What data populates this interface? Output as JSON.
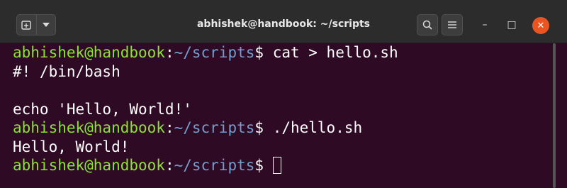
{
  "window": {
    "title": "abhishek@handbook: ~/scripts"
  },
  "toolbar": {
    "new_tab_icon": "new-tab-icon",
    "menu_icon": "chevron-down-icon",
    "search_icon": "search-icon",
    "hamburger_icon": "hamburger-menu-icon",
    "minimize_glyph": "–",
    "maximize_glyph": "□",
    "close_glyph": "✕"
  },
  "terminal": {
    "user_host": "abhishek@handbook",
    "colon": ":",
    "path": "~/scripts",
    "dollar": "$",
    "lines": [
      {
        "type": "prompt",
        "command": " cat > hello.sh"
      },
      {
        "type": "output",
        "text": "#! /bin/bash"
      },
      {
        "type": "output",
        "text": ""
      },
      {
        "type": "output",
        "text": "echo 'Hello, World!'"
      },
      {
        "type": "prompt",
        "command": " ./hello.sh"
      },
      {
        "type": "output",
        "text": "Hello, World!"
      },
      {
        "type": "prompt",
        "command": " "
      }
    ]
  },
  "colors": {
    "background": "#2f0a24",
    "user_host": "#8ae234",
    "path": "#729fcf",
    "text": "#ffffff",
    "close": "#e95420"
  }
}
